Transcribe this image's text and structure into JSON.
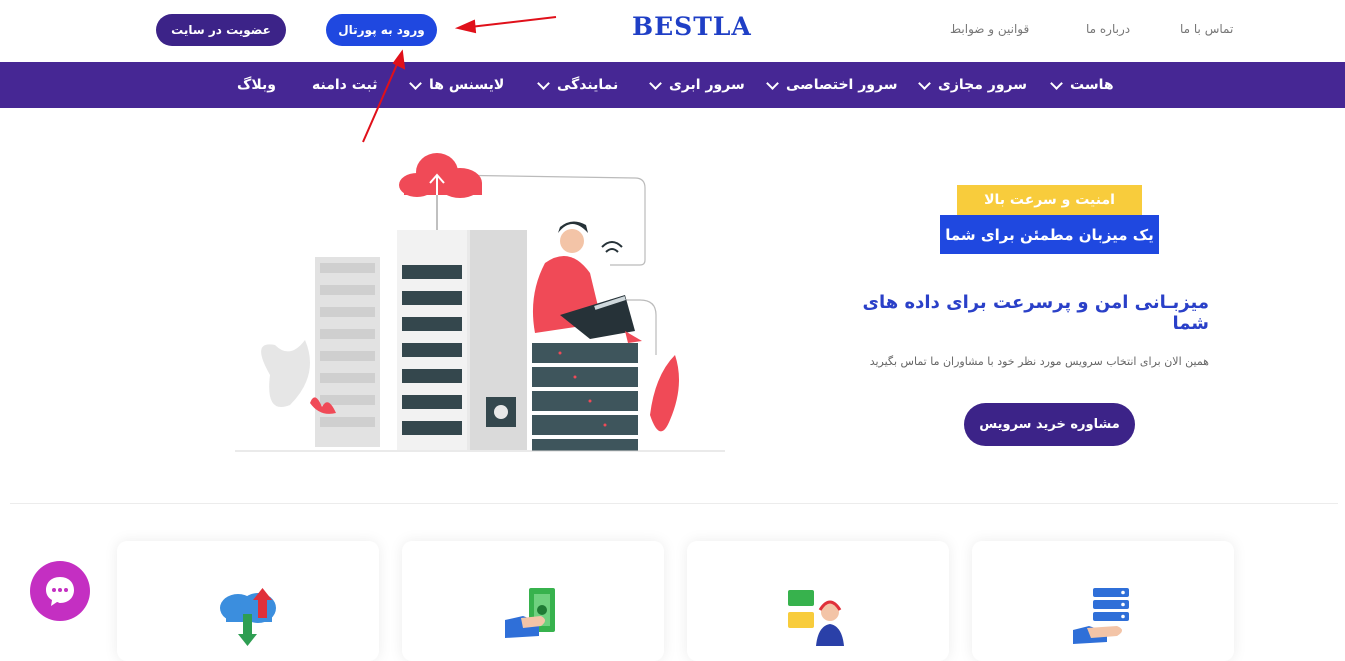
{
  "header": {
    "logo": "BESTLA",
    "register_button": "عضویت در سایت",
    "portal_button": "ورود به پورتال",
    "links": [
      "تماس با ما",
      "درباره ما",
      "قوانین و ضوابط"
    ]
  },
  "nav": {
    "items": [
      {
        "label": "هاست"
      },
      {
        "label": "سرور مجازی"
      },
      {
        "label": "سرور اختصاصی"
      },
      {
        "label": "سرور ابری"
      },
      {
        "label": "نمایندگی"
      },
      {
        "label": "لایسنس ها"
      },
      {
        "label": "ثبت دامنه"
      },
      {
        "label": "وبلاگ"
      }
    ]
  },
  "hero": {
    "badge_yellow": "امنیت و سرعت بالا",
    "badge_blue": "یک میزبان مطمئن برای شما",
    "title": "میزبـانی امن و پرسرعت برای داده های شما",
    "subtitle": "همین الان برای انتخاب سرویس مورد نظر خود با مشاوران ما تماس بگیرید",
    "cta": "مشاوره خرید سرویس"
  },
  "cards": {
    "icons": [
      "cloud-transfer-icon",
      "cash-hand-icon",
      "support-agent-icon",
      "server-hand-icon"
    ]
  },
  "colors": {
    "brand_purple": "#462794",
    "button_purple": "#3c2388",
    "brand_blue": "#1f48e0",
    "accent_yellow": "#f8cc3c",
    "chat_pink": "#c42fc2",
    "annotation_red": "#e0101a"
  }
}
